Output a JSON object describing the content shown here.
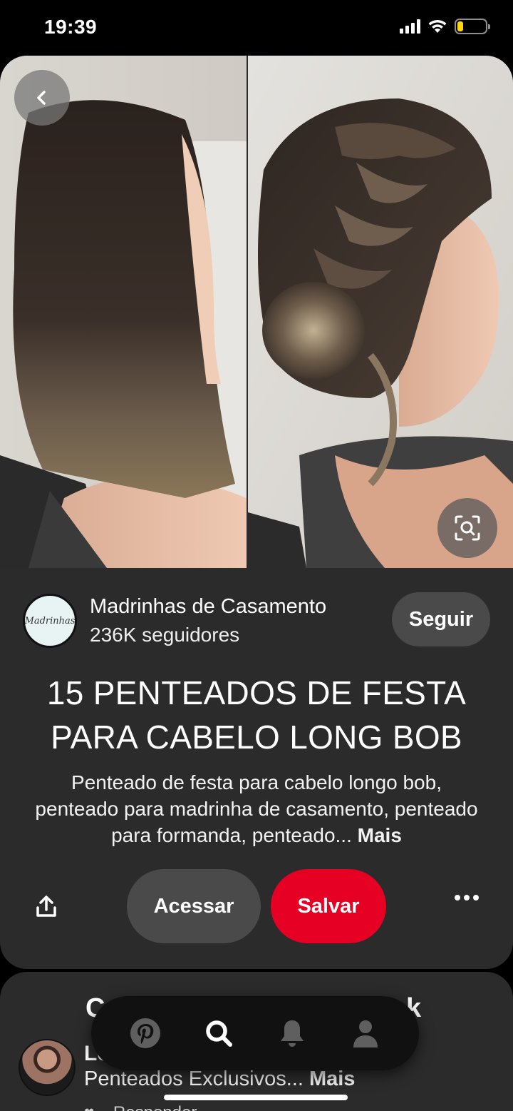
{
  "status_bar": {
    "time": "19:39",
    "battery_level": 0.22,
    "battery_color": "#ffd60a"
  },
  "pin": {
    "image_alt_icons": [
      "back-icon",
      "visual-search-icon"
    ],
    "creator": {
      "avatar_text": "Madrinhas",
      "name": "Madrinhas de Casamento",
      "followers": "236K seguidores",
      "follow_label": "Seguir"
    },
    "title": "15 PENTEADOS DE FESTA PARA CABELO LONG BOB",
    "description": "Penteado de festa para cabelo longo bob, penteado para madrinha de casamento, penteado para formanda, penteado...",
    "more_label": "Mais",
    "actions": {
      "visit_label": "Acessar",
      "save_label": "Salvar"
    },
    "colors": {
      "save": "#e60023",
      "card": "#2b2b2b",
      "secondary_button": "#4a4a4a"
    }
  },
  "comments": {
    "title_start": "C",
    "title_end": "k",
    "commenter_name": "Lc",
    "comment_text": "Penteados Exclusivos...",
    "comment_more": "Mais",
    "reply_label": "Responder"
  },
  "bottom_nav": {
    "items": [
      "pinterest-home-icon",
      "search-icon",
      "notifications-icon",
      "profile-icon"
    ],
    "active": "search-icon"
  }
}
